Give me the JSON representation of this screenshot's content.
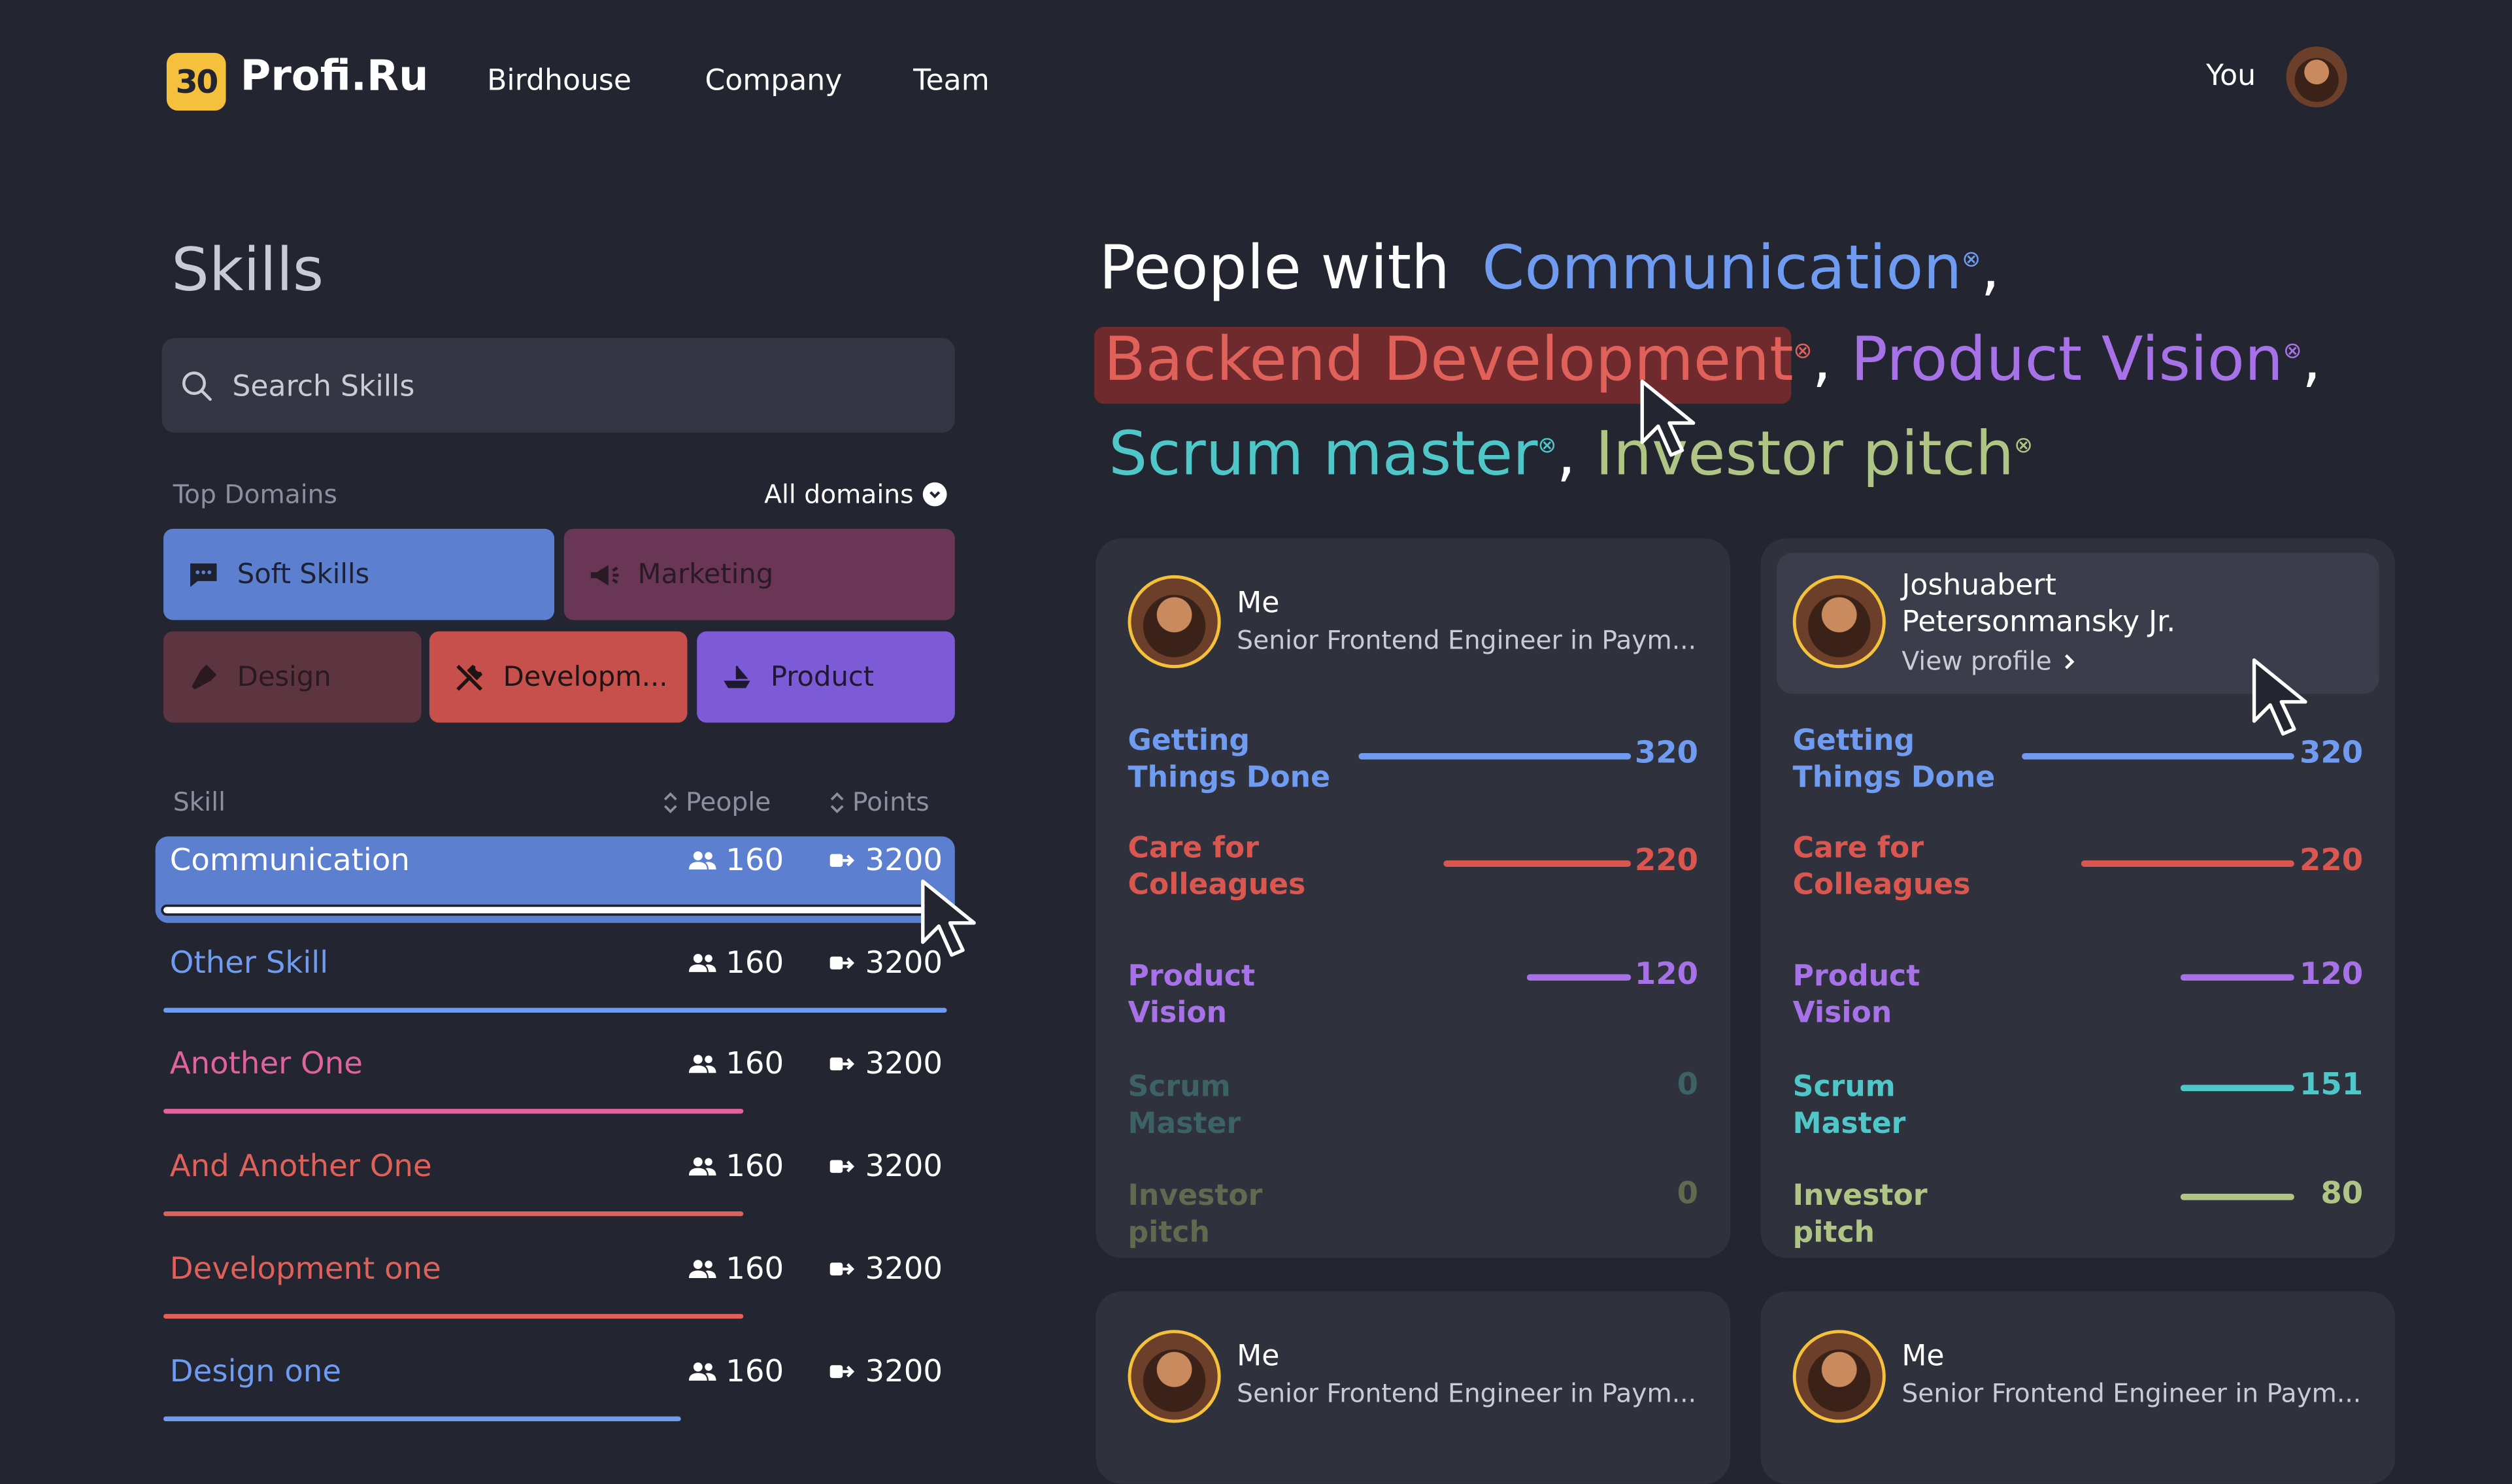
{
  "colors": {
    "background": "#232530",
    "panel": "#2f313d",
    "accent_yellow": "#f5c13d",
    "blue": "#6f9cf0",
    "red": "#d9574f",
    "purple": "#a772e8",
    "teal": "#4fc6c8",
    "olive": "#b0c585",
    "pink": "#d05a9a"
  },
  "header": {
    "logo_mark": "30",
    "logo_text": "Profi.Ru",
    "nav": [
      "Birdhouse",
      "Company",
      "Team"
    ],
    "user_label": "You"
  },
  "skills_panel": {
    "title": "Skills",
    "search_placeholder": "Search Skills",
    "top_domains_label": "Top Domains",
    "all_domains_label": "All domains",
    "domains": [
      {
        "label": "Soft Skills",
        "icon": "chat-icon",
        "color": "#5c7fcf"
      },
      {
        "label": "Marketing",
        "icon": "megaphone-icon",
        "color": "#6a3656"
      },
      {
        "label": "Design",
        "icon": "pen-tool-icon",
        "color": "#5c3540"
      },
      {
        "label": "Developm...",
        "icon": "tools-icon",
        "color": "#c8504c"
      },
      {
        "label": "Product",
        "icon": "ship-icon",
        "color": "#7d5ad6"
      }
    ],
    "columns": {
      "skill": "Skill",
      "people": "People",
      "points": "Points"
    },
    "rows": [
      {
        "name": "Communication",
        "people": "160",
        "points": "3200",
        "color": "#ffffff",
        "selected": true,
        "progress": 1.0
      },
      {
        "name": "Other Skill",
        "people": "160",
        "points": "3200",
        "color": "#6f9cf0",
        "progress": 1.0
      },
      {
        "name": "Another One",
        "people": "160",
        "points": "3200",
        "color": "#e0629f",
        "progress": 0.74
      },
      {
        "name": "And Another One",
        "people": "160",
        "points": "3200",
        "color": "#e0605a",
        "progress": 0.74
      },
      {
        "name": "Development one",
        "people": "160",
        "points": "3200",
        "color": "#e0605a",
        "progress": 0.74
      },
      {
        "name": "Design one",
        "people": "160",
        "points": "3200",
        "color": "#6f9cf0",
        "progress": 0.66
      }
    ]
  },
  "people_panel": {
    "heading_prefix": "People with",
    "selected_skills": [
      {
        "label": "Communication",
        "color": "#6f9cf0"
      },
      {
        "label": "Backend Development",
        "color": "#e0605a",
        "highlighted": true
      },
      {
        "label": "Product Vision",
        "color": "#a772e8"
      },
      {
        "label": "Scrum master",
        "color": "#4fc6c8"
      },
      {
        "label": "Investor pitch",
        "color": "#b0c585"
      }
    ],
    "chip_remove_glyph": "⊗",
    "comma": ",",
    "cards": [
      {
        "name": "Me",
        "role": "Senior Frontend Engineer in Paym...",
        "metrics": [
          {
            "label": "Getting Things Done",
            "value": "320",
            "fraction": 1.0
          },
          {
            "label": "Care for Colleagues",
            "value": "220",
            "fraction": 0.69
          },
          {
            "label": "Product Vision",
            "value": "120",
            "fraction": 0.38
          },
          {
            "label": "Scrum Master",
            "value": "0",
            "fraction": 0,
            "dimmed": true
          },
          {
            "label": "Investor pitch",
            "value": "0",
            "fraction": 0,
            "dimmed": true
          }
        ]
      },
      {
        "name_line1": "Joshuabert",
        "name_line2": "Petersonmansky Jr.",
        "view_profile": "View profile",
        "metrics": [
          {
            "label": "Getting Things Done",
            "value": "320",
            "fraction": 1.0
          },
          {
            "label": "Care for Colleagues",
            "value": "220",
            "fraction": 0.78
          },
          {
            "label": "Product Vision",
            "value": "120",
            "fraction": 0.42
          },
          {
            "label": "Scrum Master",
            "value": "151",
            "fraction": 0.42
          },
          {
            "label": "Investor pitch",
            "value": "80",
            "fraction": 0.42
          }
        ]
      },
      {
        "name": "Me",
        "role": "Senior Frontend Engineer in Paym..."
      },
      {
        "name": "Me",
        "role": "Senior Frontend Engineer in Paym..."
      }
    ]
  }
}
